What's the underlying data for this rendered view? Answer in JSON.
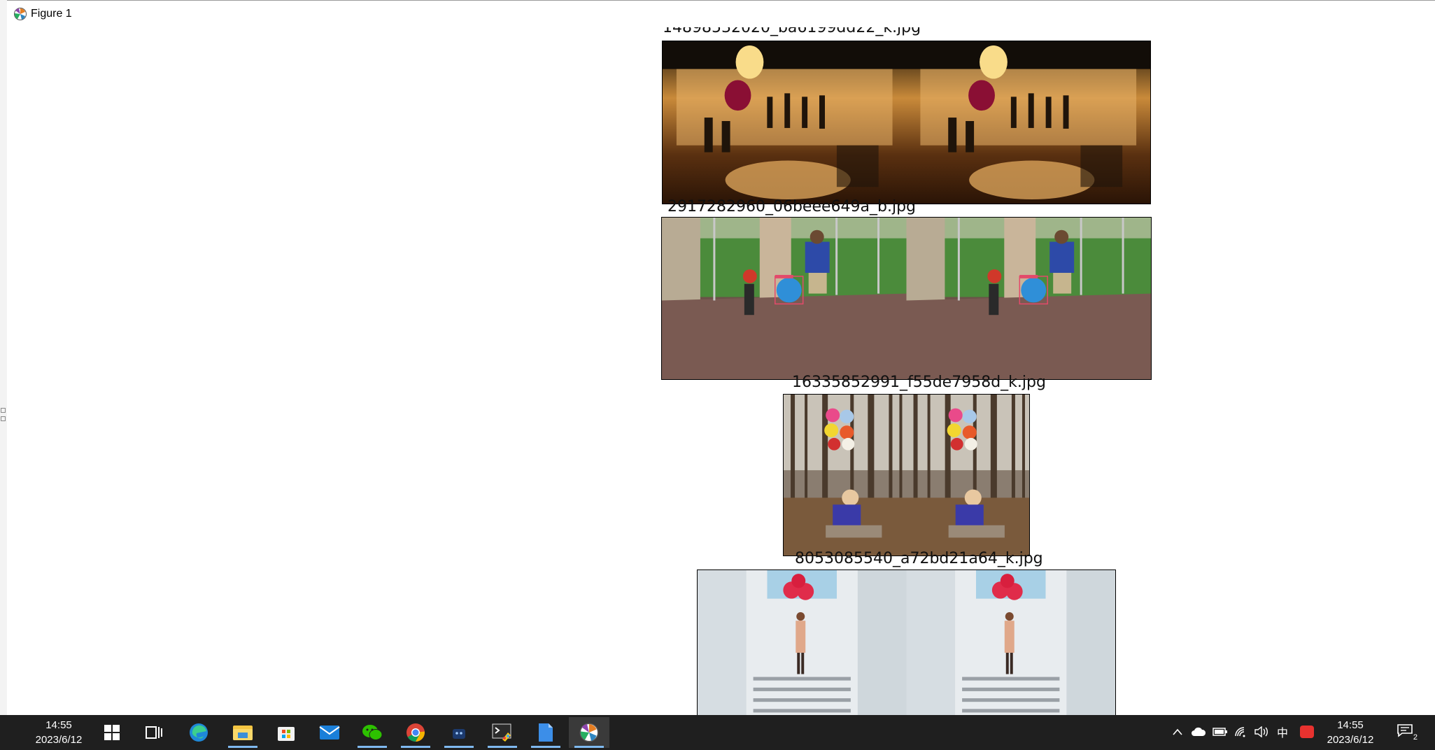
{
  "window": {
    "title": "Figure 1",
    "app_icon": "matplotlib-icon"
  },
  "figure": {
    "subplots": [
      {
        "caption": "14898532020_ba6199dd22_k.jpg",
        "content": "night tent party with glowing lanterns and pink balloon"
      },
      {
        "caption": "2917282960_06beee649a_b.jpg",
        "content": "boy and child with blue ball on tiled porch",
        "detection_label": "balloon"
      },
      {
        "caption": "16335852991_f55de7958d_k.jpg",
        "content": "child sitting on log holding colorful balloons in bare forest"
      },
      {
        "caption": "8053085540_a72bd21a64_k.jpg",
        "content": "woman on white stairs holding red balloons"
      }
    ]
  },
  "taskbar": {
    "time": "14:55",
    "date": "2023/6/12",
    "apps": [
      {
        "name": "start-icon"
      },
      {
        "name": "task-view-icon"
      },
      {
        "name": "edge-icon"
      },
      {
        "name": "file-explorer-icon"
      },
      {
        "name": "store-icon"
      },
      {
        "name": "mail-icon"
      },
      {
        "name": "wechat-icon"
      },
      {
        "name": "chrome-icon"
      },
      {
        "name": "app-blue-icon"
      },
      {
        "name": "paint-terminal-icon"
      },
      {
        "name": "notepad-icon"
      },
      {
        "name": "matplotlib-icon"
      }
    ],
    "tray": {
      "ime": "中",
      "sogou": "S",
      "notifications": "2"
    }
  }
}
